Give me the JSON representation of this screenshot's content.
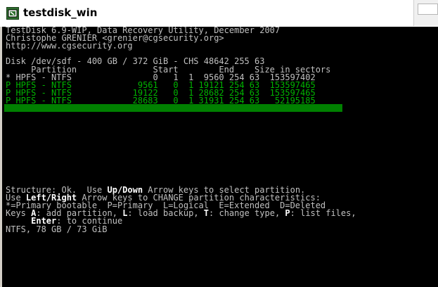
{
  "window": {
    "title": "testdisk_win",
    "icon": "disk-app-icon"
  },
  "console": {
    "header": [
      "TestDisk 6.9-WIP, Data Recovery Utility, December 2007",
      "Christophe GRENIER <grenier@cgsecurity.org>",
      "http://www.cgsecurity.org"
    ],
    "disk_line": "Disk /dev/sdf - 400 GB / 372 GiB - CHS 48642 255 63",
    "table_header": "     Partition               Start        End    Size in sectors",
    "partitions": [
      "* HPFS - NTFS                0   1  1  9560 254 63  153597402",
      "P HPFS - NTFS             9561   0  1 19121 254 63  153597465",
      "P HPFS - NTFS            19122   0  1 28682 254 63  153597465",
      "P HPFS - NTFS            28683   0  1 31931 254 63   52195185"
    ],
    "footer": {
      "line1_a": "Structure: Ok.  Use ",
      "line1_b": "Up/Down",
      "line1_c": " Arrow keys to select partition.",
      "line2_a": "Use ",
      "line2_b": "Left/Right",
      "line2_c": " Arrow keys to CHANGE partition characteristics:",
      "line3": "*=Primary bootable  P=Primary  L=Logical  E=Extended  D=Deleted",
      "line4_a": "Keys ",
      "line4_b": "A",
      "line4_c": ": add partition, ",
      "line4_d": "L",
      "line4_e": ": load backup, ",
      "line4_f": "T",
      "line4_g": ": change type, ",
      "line4_h": "P",
      "line4_i": ": list files,",
      "line5_a": "     ",
      "line5_b": "Enter",
      "line5_c": ": to continue",
      "status": "NTFS, 78 GB / 73 GiB"
    }
  },
  "colors": {
    "selection_bg": "#008000",
    "text": "#c0c0c0",
    "partition_text": "#00b400",
    "highlight": "#ffffff"
  }
}
